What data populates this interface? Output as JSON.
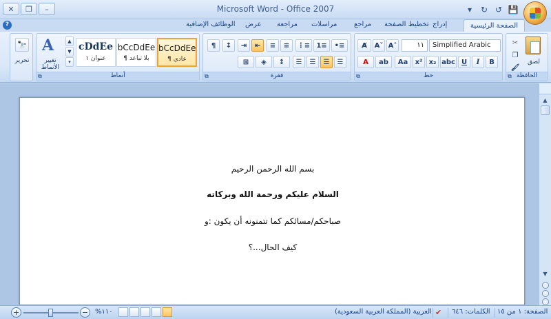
{
  "app": {
    "title": "Microsoft Word - Office 2007"
  },
  "window": {
    "close": "✕",
    "restore": "❐",
    "minimize": "–"
  },
  "qat": {
    "dropdown": "▾",
    "redo": "↻",
    "undo": "↺",
    "save": "💾"
  },
  "tabs": [
    {
      "label": "الصفحة الرئيسية",
      "active": true
    },
    {
      "label": "إدراج"
    },
    {
      "label": "تخطيط الصفحة"
    },
    {
      "label": "مراجع"
    },
    {
      "label": "مراسلات"
    },
    {
      "label": "مراجعة"
    },
    {
      "label": "عرض"
    },
    {
      "label": "الوظائف الإضافية"
    }
  ],
  "ribbon": {
    "clipboard": {
      "label": "الحافظة",
      "paste": "لصق"
    },
    "font": {
      "label": "خط",
      "size": "١١",
      "name": "Simplified Arabic"
    },
    "paragraph": {
      "label": "فقرة"
    },
    "styles": {
      "label": "أنماط",
      "items": [
        {
          "sample": "bCcDdEe",
          "name": "¶ عادي",
          "selected": true
        },
        {
          "sample": "bCcDdEe",
          "name": "¶ بلا تباعد"
        },
        {
          "sample": "cDdEe",
          "name": "عنوان ١"
        }
      ],
      "change_styles": "تغيير الأنماط"
    },
    "editing": {
      "label": "تحرير"
    }
  },
  "document": {
    "lines": [
      "بسم الله الرحمن الرحيم",
      "السلام عليكم ورحمة الله وبركاته",
      "صباحكم/مسائكم كما تتمنونه أن يكون :و",
      "كيف الحال...؟"
    ]
  },
  "status": {
    "page": "الصفحة: ١ من ١٥",
    "words": "الكلمات: ٦٤٦",
    "language": "العربية (المملكة العربية السعودية)",
    "zoom": "١١٠%"
  }
}
